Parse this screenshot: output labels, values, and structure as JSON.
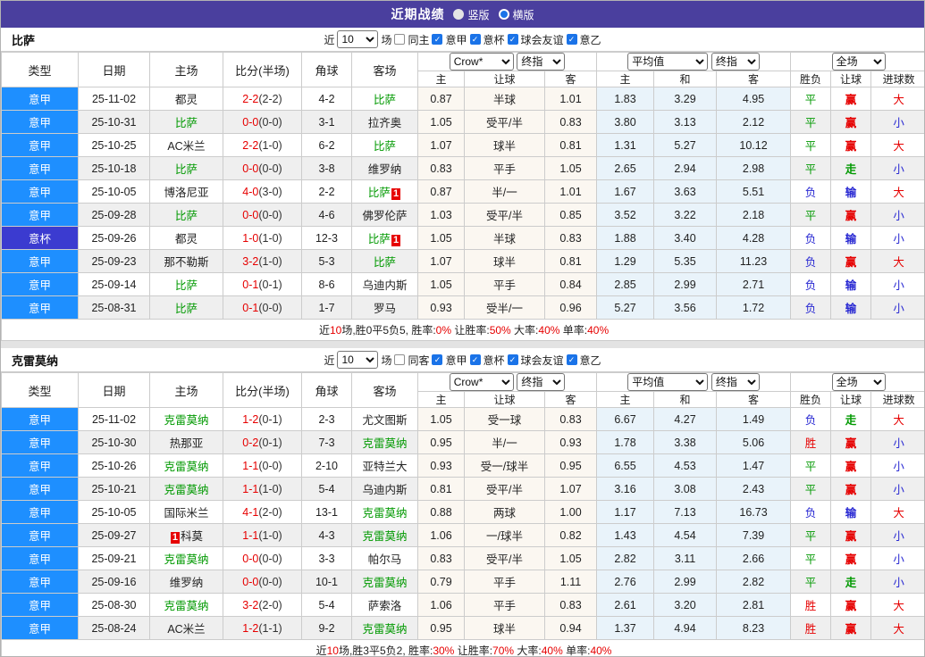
{
  "title_bar": {
    "title": "近期战绩",
    "options": [
      {
        "label": "竖版",
        "selected": false
      },
      {
        "label": "横版",
        "selected": true
      }
    ]
  },
  "filter": {
    "near_label": "近",
    "count": "10",
    "games_label": "场"
  },
  "columns": {
    "static": [
      "类型",
      "日期",
      "主场",
      "比分(半场)",
      "角球",
      "客场"
    ],
    "selects": {
      "crow": "Crow*",
      "final1": "终指",
      "avg": "平均值",
      "final2": "终指",
      "full": "全场"
    },
    "sub": [
      "主",
      "让球",
      "客",
      "主",
      "和",
      "客",
      "胜负",
      "让球",
      "进球数"
    ]
  },
  "colors": {
    "header_purple": "#4a3f9e",
    "league_blue": "#1e8fff",
    "cup_blue": "#3b3bd0",
    "focus_team_green": "#009900",
    "score_red": "#e60000",
    "verdict_red": "#e60000",
    "verdict_green": "#009900",
    "verdict_blue": "#2828d2",
    "crow_column_bg": "#fbf7f1",
    "average_column_bg": "#e9f3fa"
  },
  "sections": [
    {
      "team": "比萨",
      "same": {
        "label": "同主",
        "checked": false
      },
      "leagues": [
        {
          "label": "意甲",
          "checked": true
        },
        {
          "label": "意杯",
          "checked": true
        },
        {
          "label": "球会友谊",
          "checked": true
        },
        {
          "label": "意乙",
          "checked": true
        }
      ],
      "rows": [
        {
          "league": "意甲",
          "cup": false,
          "date": "25-11-02",
          "home": {
            "name": "都灵"
          },
          "score_ft": "2-2",
          "score_ht": "(2-2)",
          "corner": "4-2",
          "away": {
            "name": "比萨",
            "focus": true
          },
          "crow": [
            "0.87",
            "半球",
            "1.01"
          ],
          "avg": [
            "1.83",
            "3.29",
            "4.95"
          ],
          "verdicts": [
            {
              "t": "平",
              "c": "green"
            },
            {
              "t": "赢",
              "c": "red"
            },
            {
              "t": "大",
              "c": "red"
            }
          ]
        },
        {
          "league": "意甲",
          "cup": false,
          "date": "25-10-31",
          "home": {
            "name": "比萨",
            "focus": true
          },
          "score_ft": "0-0",
          "score_ht": "(0-0)",
          "corner": "3-1",
          "away": {
            "name": "拉齐奥"
          },
          "crow": [
            "1.05",
            "受平/半",
            "0.83"
          ],
          "avg": [
            "3.80",
            "3.13",
            "2.12"
          ],
          "verdicts": [
            {
              "t": "平",
              "c": "green"
            },
            {
              "t": "赢",
              "c": "red"
            },
            {
              "t": "小",
              "c": "blue"
            }
          ]
        },
        {
          "league": "意甲",
          "cup": false,
          "date": "25-10-25",
          "home": {
            "name": "AC米兰"
          },
          "score_ft": "2-2",
          "score_ht": "(1-0)",
          "corner": "6-2",
          "away": {
            "name": "比萨",
            "focus": true
          },
          "crow": [
            "1.07",
            "球半",
            "0.81"
          ],
          "avg": [
            "1.31",
            "5.27",
            "10.12"
          ],
          "verdicts": [
            {
              "t": "平",
              "c": "green"
            },
            {
              "t": "赢",
              "c": "red"
            },
            {
              "t": "大",
              "c": "red"
            }
          ]
        },
        {
          "league": "意甲",
          "cup": false,
          "date": "25-10-18",
          "home": {
            "name": "比萨",
            "focus": true
          },
          "score_ft": "0-0",
          "score_ht": "(0-0)",
          "corner": "3-8",
          "away": {
            "name": "维罗纳"
          },
          "crow": [
            "0.83",
            "平手",
            "1.05"
          ],
          "avg": [
            "2.65",
            "2.94",
            "2.98"
          ],
          "verdicts": [
            {
              "t": "平",
              "c": "green"
            },
            {
              "t": "走",
              "c": "green"
            },
            {
              "t": "小",
              "c": "blue"
            }
          ]
        },
        {
          "league": "意甲",
          "cup": false,
          "date": "25-10-05",
          "home": {
            "name": "博洛尼亚"
          },
          "score_ft": "4-0",
          "score_ht": "(3-0)",
          "corner": "2-2",
          "away": {
            "name": "比萨",
            "focus": true,
            "badge": "1",
            "badge_pos": "after"
          },
          "crow": [
            "0.87",
            "半/一",
            "1.01"
          ],
          "avg": [
            "1.67",
            "3.63",
            "5.51"
          ],
          "verdicts": [
            {
              "t": "负",
              "c": "blue"
            },
            {
              "t": "输",
              "c": "blue"
            },
            {
              "t": "大",
              "c": "red"
            }
          ]
        },
        {
          "league": "意甲",
          "cup": false,
          "date": "25-09-28",
          "home": {
            "name": "比萨",
            "focus": true
          },
          "score_ft": "0-0",
          "score_ht": "(0-0)",
          "corner": "4-6",
          "away": {
            "name": "佛罗伦萨"
          },
          "crow": [
            "1.03",
            "受平/半",
            "0.85"
          ],
          "avg": [
            "3.52",
            "3.22",
            "2.18"
          ],
          "verdicts": [
            {
              "t": "平",
              "c": "green"
            },
            {
              "t": "赢",
              "c": "red"
            },
            {
              "t": "小",
              "c": "blue"
            }
          ]
        },
        {
          "league": "意杯",
          "cup": true,
          "date": "25-09-26",
          "home": {
            "name": "都灵"
          },
          "score_ft": "1-0",
          "score_ht": "(1-0)",
          "corner": "12-3",
          "away": {
            "name": "比萨",
            "focus": true,
            "badge": "1",
            "badge_pos": "after"
          },
          "crow": [
            "1.05",
            "半球",
            "0.83"
          ],
          "avg": [
            "1.88",
            "3.40",
            "4.28"
          ],
          "verdicts": [
            {
              "t": "负",
              "c": "blue"
            },
            {
              "t": "输",
              "c": "blue"
            },
            {
              "t": "小",
              "c": "blue"
            }
          ]
        },
        {
          "league": "意甲",
          "cup": false,
          "date": "25-09-23",
          "home": {
            "name": "那不勒斯"
          },
          "score_ft": "3-2",
          "score_ht": "(1-0)",
          "corner": "5-3",
          "away": {
            "name": "比萨",
            "focus": true
          },
          "crow": [
            "1.07",
            "球半",
            "0.81"
          ],
          "avg": [
            "1.29",
            "5.35",
            "11.23"
          ],
          "verdicts": [
            {
              "t": "负",
              "c": "blue"
            },
            {
              "t": "赢",
              "c": "red"
            },
            {
              "t": "大",
              "c": "red"
            }
          ]
        },
        {
          "league": "意甲",
          "cup": false,
          "date": "25-09-14",
          "home": {
            "name": "比萨",
            "focus": true
          },
          "score_ft": "0-1",
          "score_ht": "(0-1)",
          "corner": "8-6",
          "away": {
            "name": "乌迪内斯"
          },
          "crow": [
            "1.05",
            "平手",
            "0.84"
          ],
          "avg": [
            "2.85",
            "2.99",
            "2.71"
          ],
          "verdicts": [
            {
              "t": "负",
              "c": "blue"
            },
            {
              "t": "输",
              "c": "blue"
            },
            {
              "t": "小",
              "c": "blue"
            }
          ]
        },
        {
          "league": "意甲",
          "cup": false,
          "date": "25-08-31",
          "home": {
            "name": "比萨",
            "focus": true
          },
          "score_ft": "0-1",
          "score_ht": "(0-0)",
          "corner": "1-7",
          "away": {
            "name": "罗马"
          },
          "crow": [
            "0.93",
            "受半/一",
            "0.96"
          ],
          "avg": [
            "5.27",
            "3.56",
            "1.72"
          ],
          "verdicts": [
            {
              "t": "负",
              "c": "blue"
            },
            {
              "t": "输",
              "c": "blue"
            },
            {
              "t": "小",
              "c": "blue"
            }
          ]
        }
      ],
      "summary": [
        {
          "t": "近",
          "c": "dark"
        },
        {
          "t": "10",
          "c": "red"
        },
        {
          "t": "场,胜0平5负5, 胜率:",
          "c": "dark"
        },
        {
          "t": "0%",
          "c": "red"
        },
        {
          "t": " 让胜率:",
          "c": "dark"
        },
        {
          "t": "50%",
          "c": "red"
        },
        {
          "t": " 大率:",
          "c": "dark"
        },
        {
          "t": "40%",
          "c": "red"
        },
        {
          "t": " 单率:",
          "c": "dark"
        },
        {
          "t": "40%",
          "c": "red"
        }
      ]
    },
    {
      "team": "克雷莫纳",
      "same": {
        "label": "同客",
        "checked": false
      },
      "leagues": [
        {
          "label": "意甲",
          "checked": true
        },
        {
          "label": "意杯",
          "checked": true
        },
        {
          "label": "球会友谊",
          "checked": true
        },
        {
          "label": "意乙",
          "checked": true
        }
      ],
      "rows": [
        {
          "league": "意甲",
          "cup": false,
          "date": "25-11-02",
          "home": {
            "name": "克雷莫纳",
            "focus": true
          },
          "score_ft": "1-2",
          "score_ht": "(0-1)",
          "corner": "2-3",
          "away": {
            "name": "尤文图斯"
          },
          "crow": [
            "1.05",
            "受一球",
            "0.83"
          ],
          "avg": [
            "6.67",
            "4.27",
            "1.49"
          ],
          "verdicts": [
            {
              "t": "负",
              "c": "blue"
            },
            {
              "t": "走",
              "c": "green"
            },
            {
              "t": "大",
              "c": "red"
            }
          ]
        },
        {
          "league": "意甲",
          "cup": false,
          "date": "25-10-30",
          "home": {
            "name": "热那亚"
          },
          "score_ft": "0-2",
          "score_ht": "(0-1)",
          "corner": "7-3",
          "away": {
            "name": "克雷莫纳",
            "focus": true
          },
          "crow": [
            "0.95",
            "半/一",
            "0.93"
          ],
          "avg": [
            "1.78",
            "3.38",
            "5.06"
          ],
          "verdicts": [
            {
              "t": "胜",
              "c": "red"
            },
            {
              "t": "赢",
              "c": "red"
            },
            {
              "t": "小",
              "c": "blue"
            }
          ]
        },
        {
          "league": "意甲",
          "cup": false,
          "date": "25-10-26",
          "home": {
            "name": "克雷莫纳",
            "focus": true
          },
          "score_ft": "1-1",
          "score_ht": "(0-0)",
          "corner": "2-10",
          "away": {
            "name": "亚特兰大"
          },
          "crow": [
            "0.93",
            "受一/球半",
            "0.95"
          ],
          "avg": [
            "6.55",
            "4.53",
            "1.47"
          ],
          "verdicts": [
            {
              "t": "平",
              "c": "green"
            },
            {
              "t": "赢",
              "c": "red"
            },
            {
              "t": "小",
              "c": "blue"
            }
          ]
        },
        {
          "league": "意甲",
          "cup": false,
          "date": "25-10-21",
          "home": {
            "name": "克雷莫纳",
            "focus": true
          },
          "score_ft": "1-1",
          "score_ht": "(1-0)",
          "corner": "5-4",
          "away": {
            "name": "乌迪内斯"
          },
          "crow": [
            "0.81",
            "受平/半",
            "1.07"
          ],
          "avg": [
            "3.16",
            "3.08",
            "2.43"
          ],
          "verdicts": [
            {
              "t": "平",
              "c": "green"
            },
            {
              "t": "赢",
              "c": "red"
            },
            {
              "t": "小",
              "c": "blue"
            }
          ]
        },
        {
          "league": "意甲",
          "cup": false,
          "date": "25-10-05",
          "home": {
            "name": "国际米兰"
          },
          "score_ft": "4-1",
          "score_ht": "(2-0)",
          "corner": "13-1",
          "away": {
            "name": "克雷莫纳",
            "focus": true
          },
          "crow": [
            "0.88",
            "两球",
            "1.00"
          ],
          "avg": [
            "1.17",
            "7.13",
            "16.73"
          ],
          "verdicts": [
            {
              "t": "负",
              "c": "blue"
            },
            {
              "t": "输",
              "c": "blue"
            },
            {
              "t": "大",
              "c": "red"
            }
          ]
        },
        {
          "league": "意甲",
          "cup": false,
          "date": "25-09-27",
          "home": {
            "name": "科莫",
            "badge": "1",
            "badge_pos": "before"
          },
          "score_ft": "1-1",
          "score_ht": "(1-0)",
          "corner": "4-3",
          "away": {
            "name": "克雷莫纳",
            "focus": true
          },
          "crow": [
            "1.06",
            "一/球半",
            "0.82"
          ],
          "avg": [
            "1.43",
            "4.54",
            "7.39"
          ],
          "verdicts": [
            {
              "t": "平",
              "c": "green"
            },
            {
              "t": "赢",
              "c": "red"
            },
            {
              "t": "小",
              "c": "blue"
            }
          ]
        },
        {
          "league": "意甲",
          "cup": false,
          "date": "25-09-21",
          "home": {
            "name": "克雷莫纳",
            "focus": true
          },
          "score_ft": "0-0",
          "score_ht": "(0-0)",
          "corner": "3-3",
          "away": {
            "name": "帕尔马"
          },
          "crow": [
            "0.83",
            "受平/半",
            "1.05"
          ],
          "avg": [
            "2.82",
            "3.11",
            "2.66"
          ],
          "verdicts": [
            {
              "t": "平",
              "c": "green"
            },
            {
              "t": "赢",
              "c": "red"
            },
            {
              "t": "小",
              "c": "blue"
            }
          ]
        },
        {
          "league": "意甲",
          "cup": false,
          "date": "25-09-16",
          "home": {
            "name": "维罗纳"
          },
          "score_ft": "0-0",
          "score_ht": "(0-0)",
          "corner": "10-1",
          "away": {
            "name": "克雷莫纳",
            "focus": true
          },
          "crow": [
            "0.79",
            "平手",
            "1.11"
          ],
          "avg": [
            "2.76",
            "2.99",
            "2.82"
          ],
          "verdicts": [
            {
              "t": "平",
              "c": "green"
            },
            {
              "t": "走",
              "c": "green"
            },
            {
              "t": "小",
              "c": "blue"
            }
          ]
        },
        {
          "league": "意甲",
          "cup": false,
          "date": "25-08-30",
          "home": {
            "name": "克雷莫纳",
            "focus": true
          },
          "score_ft": "3-2",
          "score_ht": "(2-0)",
          "corner": "5-4",
          "away": {
            "name": "萨索洛"
          },
          "crow": [
            "1.06",
            "平手",
            "0.83"
          ],
          "avg": [
            "2.61",
            "3.20",
            "2.81"
          ],
          "verdicts": [
            {
              "t": "胜",
              "c": "red"
            },
            {
              "t": "赢",
              "c": "red"
            },
            {
              "t": "大",
              "c": "red"
            }
          ]
        },
        {
          "league": "意甲",
          "cup": false,
          "date": "25-08-24",
          "home": {
            "name": "AC米兰"
          },
          "score_ft": "1-2",
          "score_ht": "(1-1)",
          "corner": "9-2",
          "away": {
            "name": "克雷莫纳",
            "focus": true
          },
          "crow": [
            "0.95",
            "球半",
            "0.94"
          ],
          "avg": [
            "1.37",
            "4.94",
            "8.23"
          ],
          "verdicts": [
            {
              "t": "胜",
              "c": "red"
            },
            {
              "t": "赢",
              "c": "red"
            },
            {
              "t": "大",
              "c": "red"
            }
          ]
        }
      ],
      "summary": [
        {
          "t": "近",
          "c": "dark"
        },
        {
          "t": "10",
          "c": "red"
        },
        {
          "t": "场,胜3平5负2, 胜率:",
          "c": "dark"
        },
        {
          "t": "30%",
          "c": "red"
        },
        {
          "t": " 让胜率:",
          "c": "dark"
        },
        {
          "t": "70%",
          "c": "red"
        },
        {
          "t": " 大率:",
          "c": "dark"
        },
        {
          "t": "40%",
          "c": "red"
        },
        {
          "t": " 单率:",
          "c": "dark"
        },
        {
          "t": "40%",
          "c": "red"
        }
      ]
    }
  ]
}
